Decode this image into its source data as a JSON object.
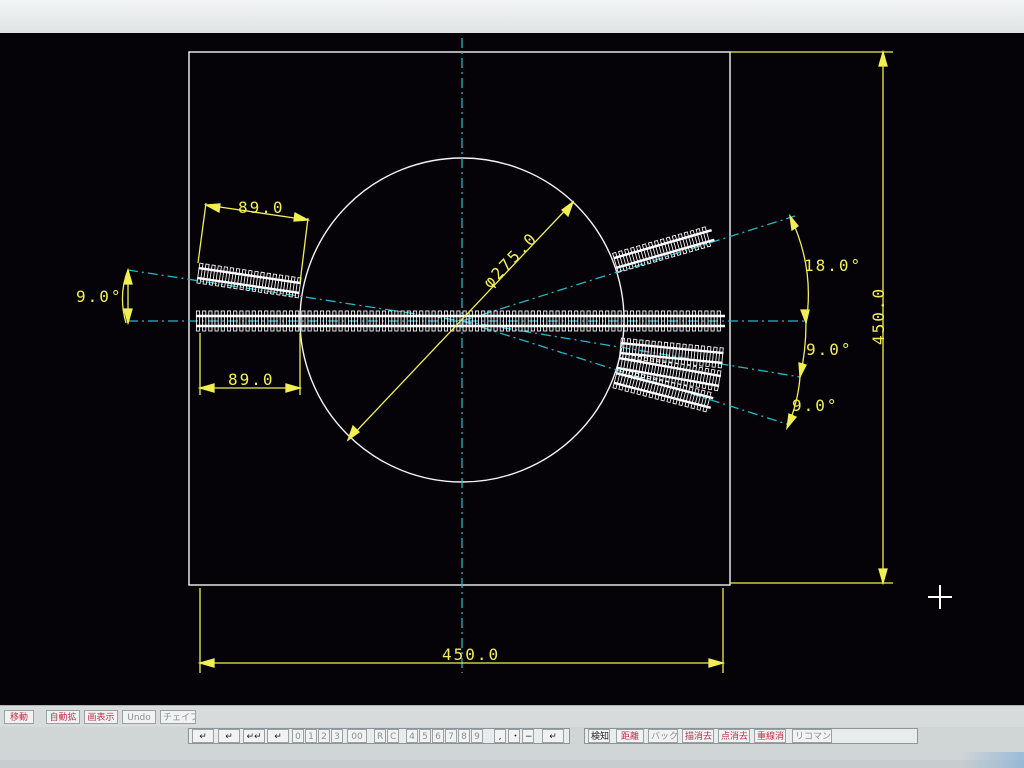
{
  "drawing": {
    "dim_top_angle_left": "9.0°",
    "dim_top_left": "89.0",
    "dim_bottom_left": "89.0",
    "dim_diameter": "φ275.0",
    "dim_angle_18": "18.0°",
    "dim_angle_9_mid": "9.0°",
    "dim_angle_9_low": "9.0°",
    "dim_height": "450.0",
    "dim_width": "450.0"
  },
  "toolbar1": {
    "buttons": [
      "移動",
      "自動拡",
      "画表示",
      "Undo",
      "チェイフ"
    ]
  },
  "toolbar2": {
    "enter_symbols": [
      "↵",
      "↵",
      "↵↵",
      "↵"
    ],
    "digits_a": [
      "0",
      "1",
      "2",
      "3",
      "00"
    ],
    "rc": [
      "R",
      "C"
    ],
    "digits_b": [
      "4",
      "5",
      "6",
      "7",
      "8",
      "9"
    ],
    "punct": [
      ",",
      "・",
      "−"
    ],
    "enter_last": "↵",
    "right_buttons": [
      "検知",
      "距離",
      "バック",
      "描消去",
      "点消去",
      "重線消",
      "リコマンド"
    ]
  },
  "colors": {
    "canvas_bg": "#050307",
    "geometry": "#f4f4f4",
    "dimension": "#f2ef52",
    "centerline": "#27b6c8"
  }
}
